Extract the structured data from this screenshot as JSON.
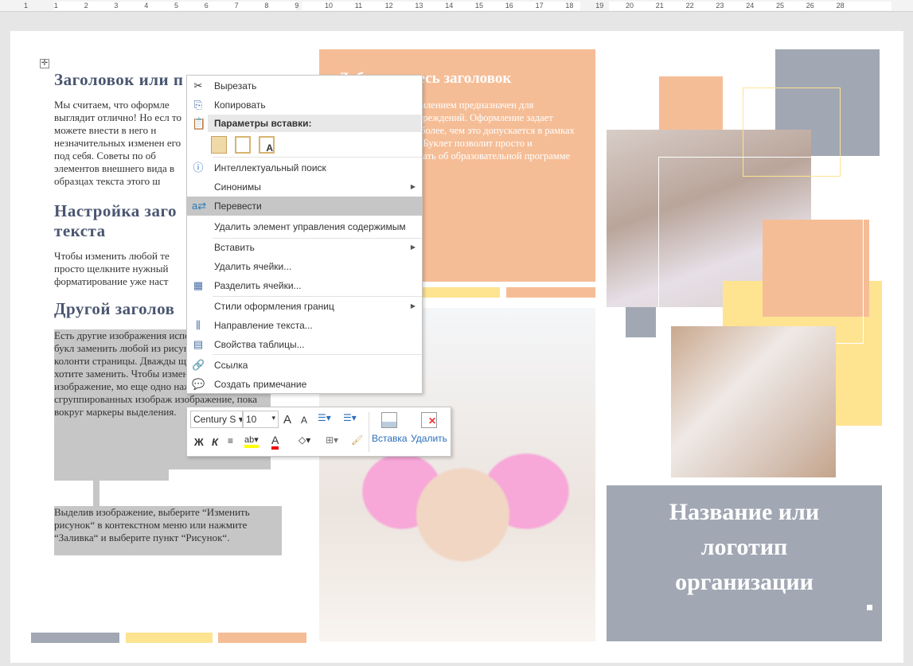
{
  "ruler": {
    "ticks": [
      "1",
      "1",
      "2",
      "3",
      "4",
      "5",
      "6",
      "7",
      "8",
      "9",
      "10",
      "11",
      "12",
      "13",
      "14",
      "15",
      "16",
      "17",
      "18",
      "19",
      "20",
      "21",
      "22",
      "23",
      "24",
      "25",
      "26",
      "28"
    ]
  },
  "left": {
    "heading1": "Заголовок или п",
    "para1": "Мы считаем, что оформле выглядит отлично! Но есл то можете внести в него н незначительных изменен его под себя. Советы по об элементов внешнего вида в образцах текста этого ш",
    "heading2": "Настройка заго текста",
    "para2": "Чтобы изменить любой те просто щелкните нужный форматирование уже наст",
    "heading3": "Другой заголов",
    "para3": "Есть другие изображения использовать? В этом букл заменить любой из рисун нажмите верхний колонти страницы. Дважды щелкн которое хотите заменить. Чтобы изменить фоновое изображение, мо еще одно нажатие, так ка сгруппированных изображ изображение, пока вокруг маркеры выделения.",
    "para4": "Выделив изображение, выберите “Изменить рисунок“ в контекстном меню или нажмите “Заливка“ и выберите пункт “Рисунок“."
  },
  "middle": {
    "heading": "Добавьте здесь заголовок",
    "text": "Этот буклет с оформлением предназначен для образовательных учреждений. Оформление задает веселый тон, но не более, чем это допускается в рамках учебного процесса. Буклет позволит просто и эффективно рассказать об образовательной программе для детей."
  },
  "org_box": {
    "title": "Название или логотип организации"
  },
  "colors": {
    "gray": "#a1a7b3",
    "orange": "#f5bd96",
    "yellow": "#fee391",
    "heading": "#4a5670"
  },
  "context_menu": {
    "items": [
      {
        "label": "Вырезать",
        "icon": "scissors-icon"
      },
      {
        "label": "Копировать",
        "icon": "copy-icon"
      },
      {
        "label": "Параметры вставки:",
        "icon": "paste-icon"
      },
      {
        "label": "Интеллектуальный поиск",
        "icon": "smart-lookup-icon"
      },
      {
        "label": "Синонимы",
        "icon": ""
      },
      {
        "label": "Перевести",
        "icon": "translate-icon"
      },
      {
        "label": "Удалить элемент управления содержимым",
        "icon": ""
      },
      {
        "label": "Вставить",
        "icon": ""
      },
      {
        "label": "Удалить ячейки...",
        "icon": ""
      },
      {
        "label": "Разделить ячейки...",
        "icon": "split-cells-icon"
      },
      {
        "label": "Стили оформления границ",
        "icon": ""
      },
      {
        "label": "Направление текста...",
        "icon": "text-direction-icon"
      },
      {
        "label": "Свойства таблицы...",
        "icon": "table-properties-icon"
      },
      {
        "label": "Ссылка",
        "icon": "link-icon"
      },
      {
        "label": "Создать примечание",
        "icon": "new-comment-icon"
      }
    ],
    "paste_option_a": "A"
  },
  "mini_toolbar": {
    "font": "Century S",
    "size": "10",
    "bold": "Ж",
    "italic": "К",
    "grow": "A",
    "shrink": "A",
    "font_color": "A",
    "insert": "Вставка",
    "delete": "Удалить"
  }
}
